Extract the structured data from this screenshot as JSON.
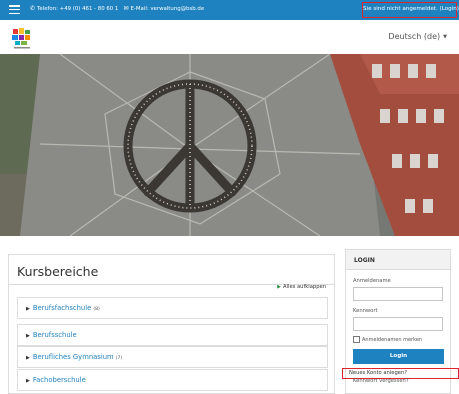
{
  "topbar": {
    "phone_text": "Telefon: +49 (0) 461 - 80 60 1",
    "email_text": "E-Mail: verwaltung@bsb.de",
    "login_status": "Sie sind nicht angemeldet. (Login)"
  },
  "header": {
    "language": "Deutsch (de)"
  },
  "main": {
    "title": "Kursbereiche",
    "collapse_all": "Alles aufklappen",
    "categories": [
      {
        "label": "Berufsfachschule",
        "count": "(8)"
      },
      {
        "label": "Berufsschule",
        "count": ""
      },
      {
        "label": "Berufliches Gymnasium",
        "count": "(7)"
      },
      {
        "label": "Fachoberschule",
        "count": ""
      }
    ]
  },
  "login": {
    "title": "LOGIN",
    "username_label": "Anmeldename",
    "password_label": "Kennwort",
    "remember_label": "Anmeldenamen merken",
    "button_label": "Login",
    "new_account": "Neues Konto anlegen?",
    "forgot": "Kennwort vergessen?"
  },
  "colors": {
    "brand_blue": "#1f82c0",
    "highlight_red": "#e0232c",
    "link_blue": "#1f82c0"
  },
  "icons": {
    "menu": "hamburger-icon",
    "phone": "phone-icon",
    "email": "mail-icon",
    "caret": "caret-down-icon",
    "chevron": "chevron-right-icon"
  }
}
